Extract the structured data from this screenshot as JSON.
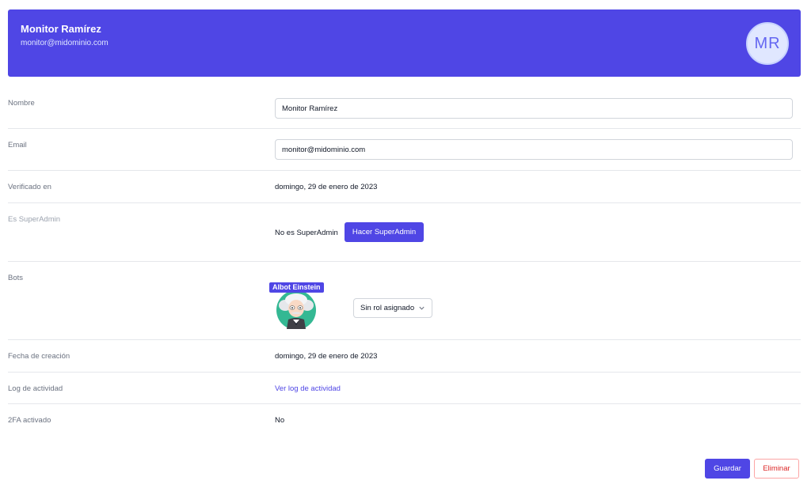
{
  "header": {
    "name": "Monitor Ramírez",
    "email": "monitor@midominio.com",
    "avatar_initials": "MR"
  },
  "fields": {
    "nombre": {
      "label": "Nombre",
      "value": "Monitor Ramírez"
    },
    "email": {
      "label": "Email",
      "value": "monitor@midominio.com"
    },
    "verificado": {
      "label": "Verificado en",
      "value": "domingo, 29 de enero de 2023"
    },
    "superadmin": {
      "label": "Es SuperAdmin",
      "status": "No es SuperAdmin",
      "button": "Hacer SuperAdmin"
    },
    "bots": {
      "label": "Bots",
      "items": [
        {
          "name": "Albot Einstein",
          "role": "Sin rol asignado",
          "icon": "einstein-avatar-icon"
        }
      ]
    },
    "creacion": {
      "label": "Fecha de creación",
      "value": "domingo, 29 de enero de 2023"
    },
    "log": {
      "label": "Log de actividad",
      "link": "Ver log de actividad"
    },
    "twofa": {
      "label": "2FA activado",
      "value": "No"
    }
  },
  "actions": {
    "save": "Guardar",
    "delete": "Eliminar"
  },
  "colors": {
    "primary": "#4f46e5",
    "danger": "#dc2626",
    "border": "#e5e7eb"
  }
}
